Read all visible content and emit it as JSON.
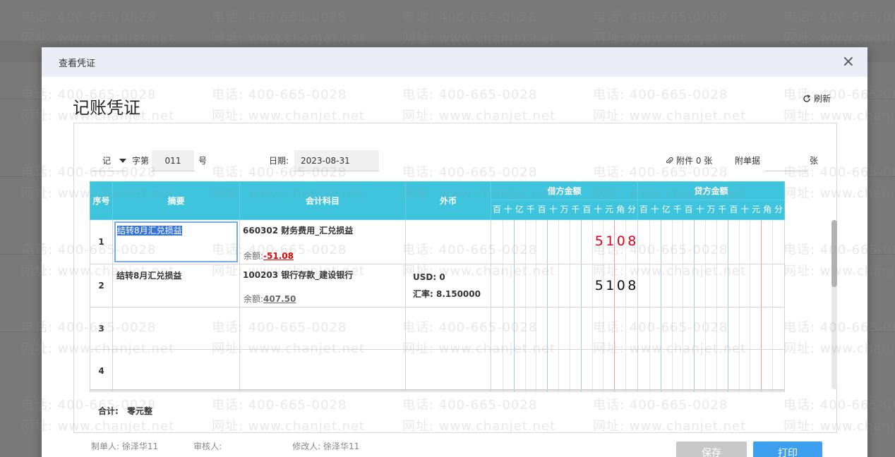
{
  "dialog": {
    "title": "查看凭证",
    "close_icon": "×",
    "voucher_title": "记账凭证",
    "refresh_label": "刷新"
  },
  "header": {
    "voucher_word": "记",
    "ziti_label": "字第",
    "voucher_number": "011",
    "hao_label": "号",
    "date_label": "日期:",
    "date_value": "2023-08-31",
    "attachment_label": "附件 0 张",
    "attach_docs_label": "附单据",
    "zhang_label": "张"
  },
  "table": {
    "headers": {
      "seq": "序号",
      "summary": "摘要",
      "account": "会计科目",
      "fx": "外币",
      "debit": "借方金额",
      "credit": "贷方金额"
    },
    "digit_units": [
      "百",
      "十",
      "亿",
      "千",
      "百",
      "十",
      "万",
      "千",
      "百",
      "十",
      "元",
      "角",
      "分"
    ],
    "rows": [
      {
        "seq": "1",
        "summary": "结转8月汇兑损益",
        "account": "660302 财务费用_汇兑损益",
        "balance_label": "余额:",
        "balance": "-51.08",
        "fx_line1": "",
        "fx_line2": "",
        "debit_digits": [
          "5",
          "1",
          "0",
          "8"
        ],
        "credit_digits": []
      },
      {
        "seq": "2",
        "summary": "结转8月汇兑损益",
        "account": "100203 银行存款_建设银行",
        "balance_label": "余额:",
        "balance": "407.50",
        "fx_line1": "USD:  0",
        "fx_line2": "汇率:  8.150000",
        "debit_digits": [
          "5",
          "1",
          "0",
          "8"
        ],
        "credit_digits": []
      },
      {
        "seq": "3",
        "summary": "",
        "account": "",
        "balance_label": "",
        "balance": "",
        "fx_line1": "",
        "fx_line2": "",
        "debit_digits": [],
        "credit_digits": []
      },
      {
        "seq": "4",
        "summary": "",
        "account": "",
        "balance_label": "",
        "balance": "",
        "fx_line1": "",
        "fx_line2": "",
        "debit_digits": [],
        "credit_digits": []
      }
    ],
    "total_label": "合计:",
    "total_value": "零元整"
  },
  "footer": {
    "maker": "制单人:  徐泽华11",
    "reviewer": "审核人:",
    "modifier": "修改人:  徐泽华11"
  },
  "buttons": {
    "save": "保存",
    "print": "打印"
  },
  "watermark": {
    "phone": "电话: 400-665-0028",
    "url": "网址: www.chanjet.net"
  },
  "colors": {
    "header_bg": "#3ec4dc",
    "print_btn": "#3c9ff0",
    "amount_red": "#e0001a",
    "highlight": "#3875d7"
  }
}
